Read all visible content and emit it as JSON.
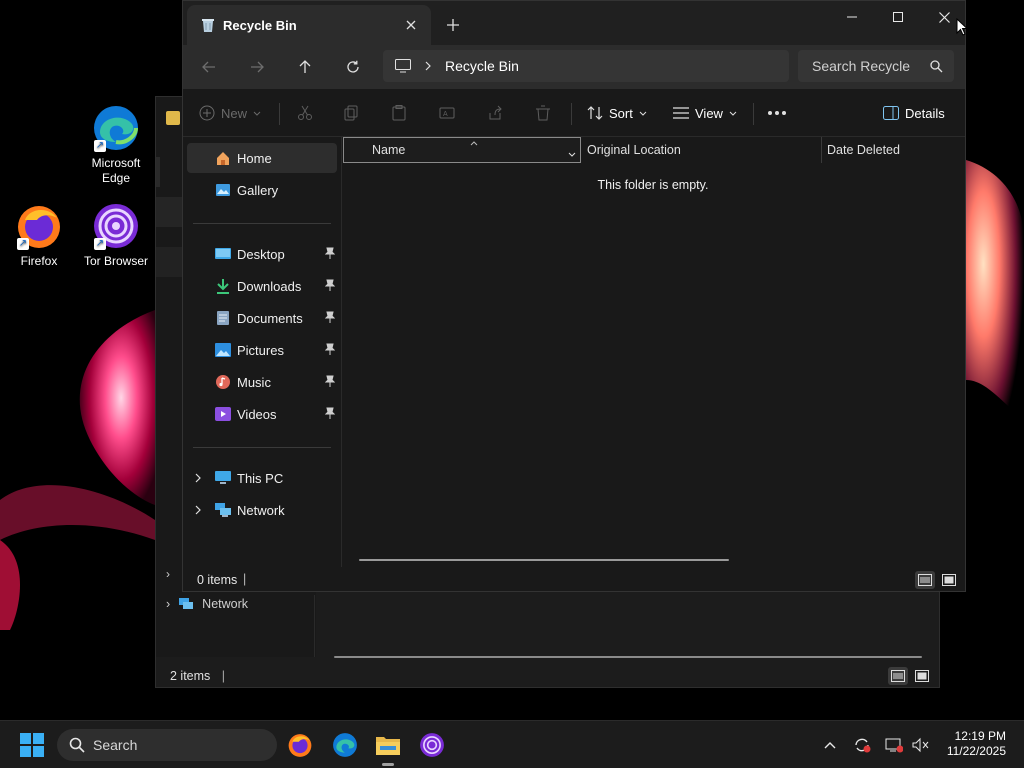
{
  "desktop": {
    "icons": [
      {
        "label": "Microsoft Edge"
      },
      {
        "label": "Firefox"
      },
      {
        "label": "Tor Browser"
      }
    ]
  },
  "background_window": {
    "nav_network": "Network",
    "status": "2 items"
  },
  "window": {
    "tab_title": "Recycle Bin",
    "address": {
      "segment": "Recycle Bin"
    },
    "search_placeholder": "Search Recycle Bin",
    "command_bar": {
      "new_label": "New",
      "sort_label": "Sort",
      "view_label": "View",
      "details_label": "Details"
    },
    "nav_pane": {
      "home": "Home",
      "gallery": "Gallery",
      "quick_access": [
        {
          "label": "Desktop"
        },
        {
          "label": "Downloads"
        },
        {
          "label": "Documents"
        },
        {
          "label": "Pictures"
        },
        {
          "label": "Music"
        },
        {
          "label": "Videos"
        }
      ],
      "this_pc": "This PC",
      "network": "Network"
    },
    "columns": {
      "name": "Name",
      "original_location": "Original Location",
      "date_deleted": "Date Deleted"
    },
    "empty_message": "This folder is empty.",
    "status": "0 items"
  },
  "taskbar": {
    "search_label": "Search",
    "time": "12:19 PM",
    "date": "11/22/2025"
  }
}
